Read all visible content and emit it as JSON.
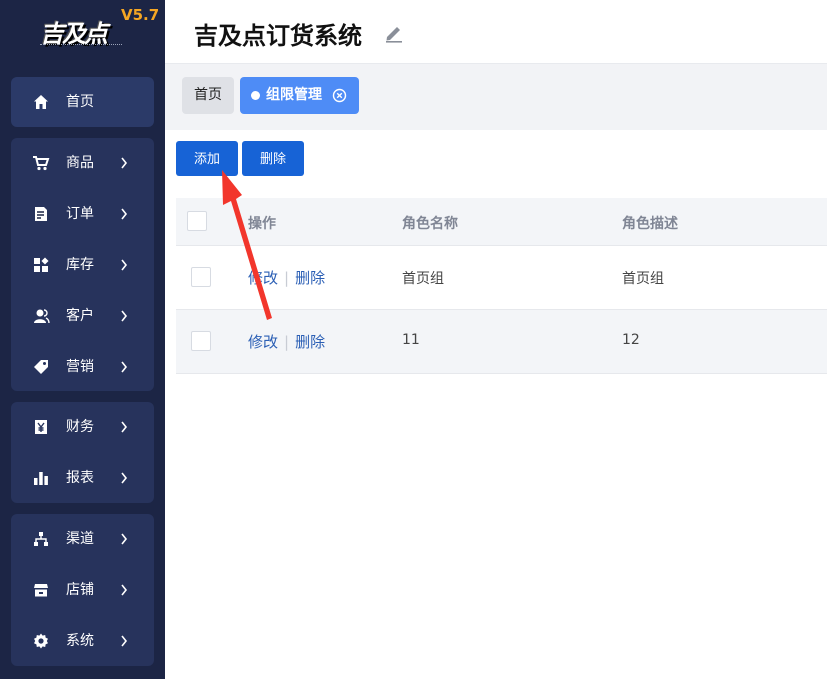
{
  "app": {
    "logo_text": "吉及点",
    "version": "V5.7",
    "title": "吉及点订货系统"
  },
  "sidebar": {
    "items": [
      {
        "label": "首页",
        "icon": "home-icon"
      },
      {
        "label": "商品",
        "icon": "cart-icon"
      },
      {
        "label": "订单",
        "icon": "order-icon"
      },
      {
        "label": "库存",
        "icon": "inventory-icon"
      },
      {
        "label": "客户",
        "icon": "customer-icon"
      },
      {
        "label": "营销",
        "icon": "tag-icon"
      },
      {
        "label": "财务",
        "icon": "yen-icon"
      },
      {
        "label": "报表",
        "icon": "bar-chart-icon"
      },
      {
        "label": "渠道",
        "icon": "channel-icon"
      },
      {
        "label": "店铺",
        "icon": "store-icon"
      },
      {
        "label": "系统",
        "icon": "gear-icon"
      }
    ]
  },
  "tabs": {
    "home_label": "首页",
    "active_label": "组限管理"
  },
  "toolbar": {
    "add_label": "添加",
    "delete_label": "删除"
  },
  "table": {
    "columns": [
      "操作",
      "角色名称",
      "角色描述"
    ],
    "edit_label": "修改",
    "delete_label": "删除",
    "rows": [
      {
        "name": "首页组",
        "description": "首页组"
      },
      {
        "name": "11",
        "description": "12"
      }
    ]
  },
  "colors": {
    "sidebar_bg": "#1c2545",
    "sidebar_group_bg": "#27335c",
    "primary_button": "#1763d6",
    "active_tab": "#4e8cf6",
    "link": "#2b5fb5",
    "annotation_arrow": "#f2362c",
    "version_badge": "#f5a623"
  }
}
